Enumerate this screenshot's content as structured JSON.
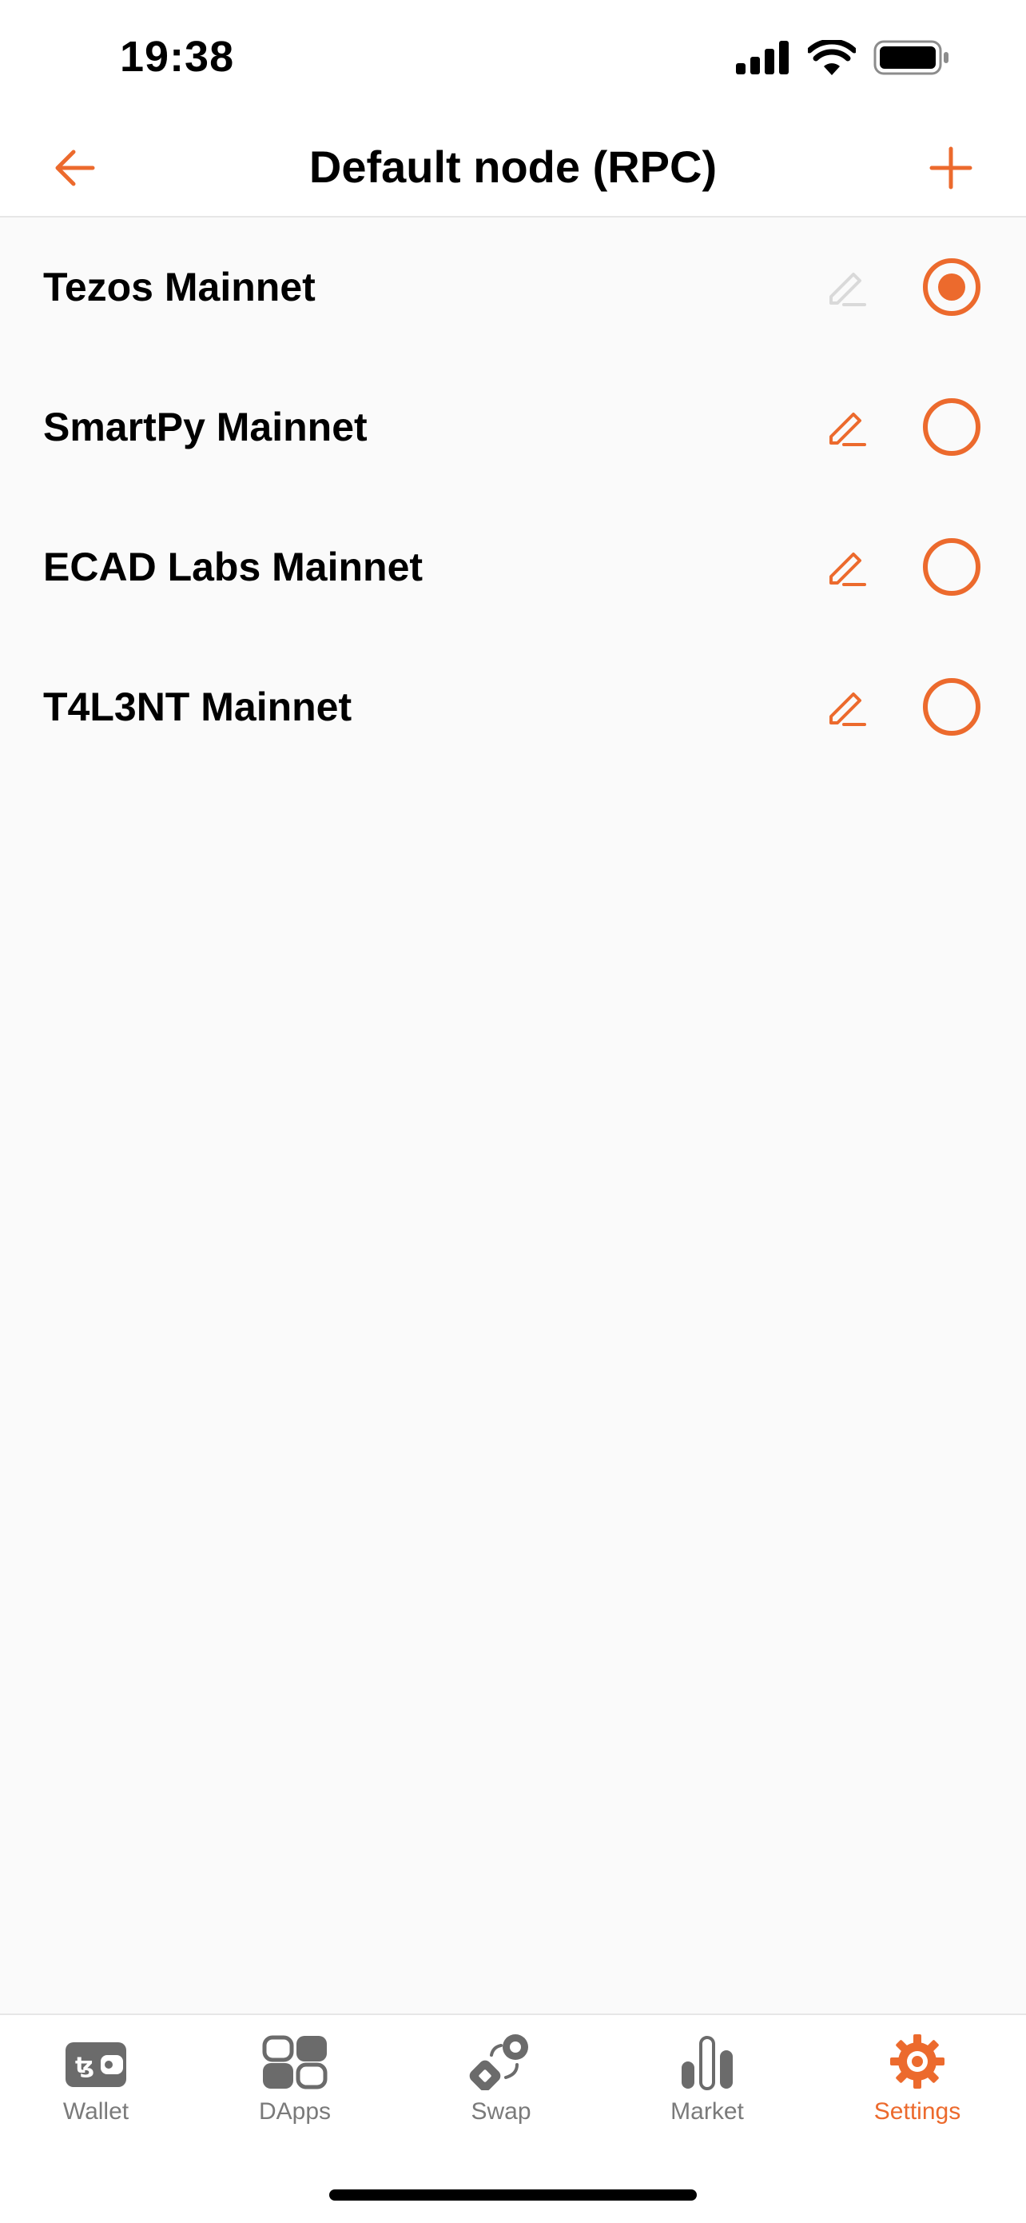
{
  "status_bar": {
    "time": "19:38",
    "icons": [
      "cellular-signal-icon",
      "wifi-icon",
      "battery-icon"
    ]
  },
  "header": {
    "title": "Default node (RPC)",
    "back_icon": "arrow-left-icon",
    "add_icon": "plus-icon"
  },
  "nodes": [
    {
      "label": "Tezos Mainnet",
      "selected": true,
      "editable": false
    },
    {
      "label": "SmartPy Mainnet",
      "selected": false,
      "editable": true
    },
    {
      "label": "ECAD Labs Mainnet",
      "selected": false,
      "editable": true
    },
    {
      "label": "T4L3NT Mainnet",
      "selected": false,
      "editable": true
    }
  ],
  "tab_bar": {
    "tabs": [
      {
        "label": "Wallet",
        "icon": "wallet-icon",
        "active": false
      },
      {
        "label": "DApps",
        "icon": "dapps-grid-icon",
        "active": false
      },
      {
        "label": "Swap",
        "icon": "swap-icon",
        "active": false
      },
      {
        "label": "Market",
        "icon": "market-bar-chart-icon",
        "active": false
      },
      {
        "label": "Settings",
        "icon": "gear-icon",
        "active": true
      }
    ]
  },
  "colors": {
    "accent": "#ec6a2d",
    "disabled_icon": "#d9d9d9",
    "tab_inactive": "#6b6b6b",
    "background": "#fafafa"
  }
}
